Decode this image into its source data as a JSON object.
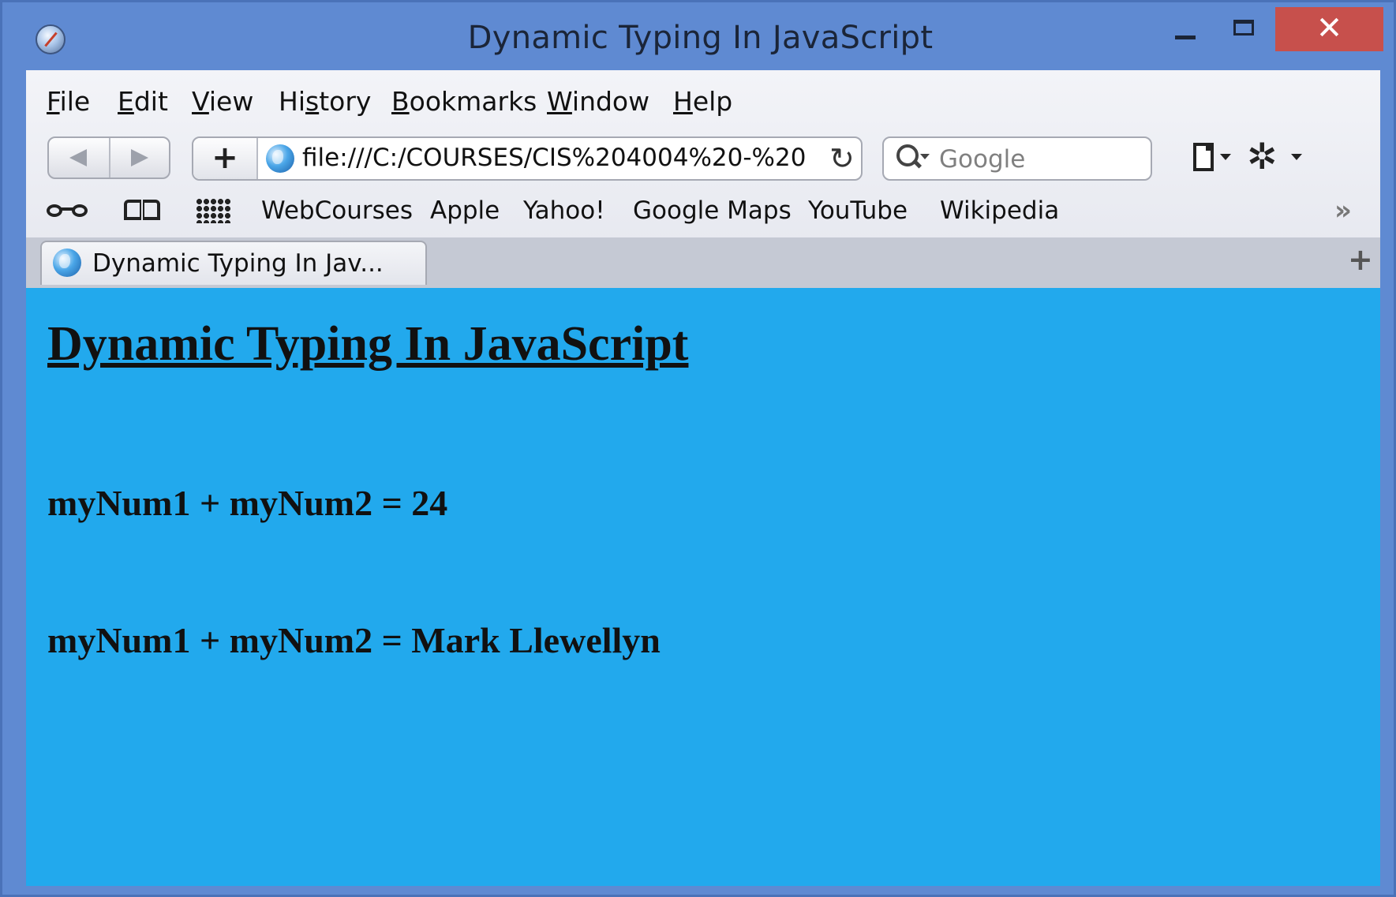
{
  "window": {
    "title": "Dynamic Typing In JavaScript",
    "close_glyph": "✕"
  },
  "menubar": {
    "items": [
      {
        "label": "File",
        "mnemonic": "F",
        "rest": "ile"
      },
      {
        "label": "Edit",
        "mnemonic": "E",
        "rest": "dit"
      },
      {
        "label": "View",
        "mnemonic": "V",
        "rest": "iew"
      },
      {
        "label": "History",
        "pre": "Hi",
        "mnemonic": "s",
        "rest": "tory"
      },
      {
        "label": "Bookmarks",
        "mnemonic": "B",
        "rest": "ookmarks"
      },
      {
        "label": "Window",
        "mnemonic": "W",
        "rest": "indow"
      },
      {
        "label": "Help",
        "mnemonic": "H",
        "rest": "elp"
      }
    ]
  },
  "toolbar": {
    "add_bookmark_glyph": "+",
    "address": "file:///C:/COURSES/CIS%204004%20-%20",
    "reload_glyph": "↻",
    "search_placeholder": "Google",
    "gear_glyph": "✲"
  },
  "bookmarks_bar": {
    "items": [
      "WebCourses",
      "Apple",
      "Yahoo!",
      "Google Maps",
      "YouTube",
      "Wikipedia"
    ],
    "overflow_glyph": "»"
  },
  "tabs": {
    "active_tab_label": "Dynamic Typing In Jav...",
    "new_tab_glyph": "+"
  },
  "page": {
    "heading": "Dynamic Typing In JavaScript",
    "result_number": "myNum1 + myNum2 = 24",
    "result_string": "myNum1 + myNum2 = Mark Llewellyn",
    "background_color": "#22a9ed"
  },
  "colors": {
    "titlebar": "#5f8ad2",
    "close_button": "#c7504c"
  }
}
